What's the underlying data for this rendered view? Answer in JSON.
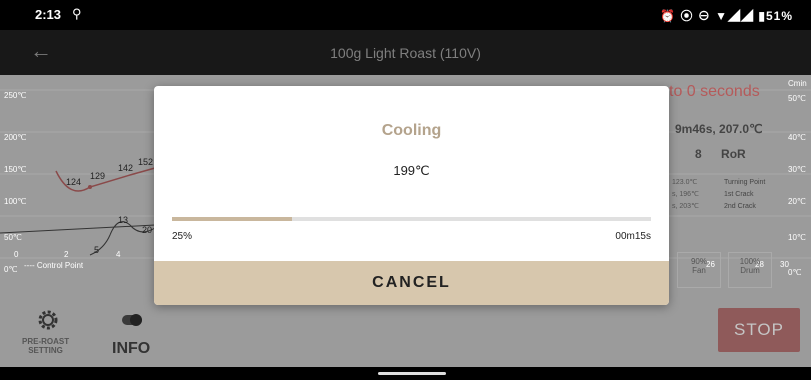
{
  "status_bar": {
    "time": "2:13",
    "battery": "51%",
    "right_icons": "⏰ ⦿ ⊖ ▼◢◢ ▮51%"
  },
  "app_bar": {
    "title": "100g Light Roast (110V)"
  },
  "chart": {
    "y_left": [
      "250℃",
      "200℃",
      "150℃",
      "100℃",
      "50℃",
      "0℃"
    ],
    "y_right": [
      "50℃",
      "40℃",
      "30℃",
      "20℃",
      "10℃",
      "0℃"
    ],
    "x_left": [
      "0",
      "2",
      "4"
    ],
    "x_right": [
      "26",
      "28",
      "30"
    ],
    "min_label": "Cmin",
    "legend": "---- Control Point",
    "marks": {
      "m124": "124",
      "m129": "129",
      "m142": "142",
      "m152": "152",
      "m13": "13",
      "m20": "20",
      "m5": "5"
    },
    "countdown": "to 0 seconds",
    "summary": "9m46s, 207.0℃",
    "summary_count": "8",
    "summary_ror": "RoR",
    "events_left": [
      "123.0℃",
      "s, 196℃",
      "s, 203℃"
    ],
    "events_right": [
      "Turning Point",
      "1st Crack",
      "2nd Crack"
    ],
    "fan": {
      "pct": "90%",
      "label": "Fan"
    },
    "drum": {
      "pct": "100%",
      "label": "Drum"
    }
  },
  "bottom": {
    "preroast_line1": "PRE-ROAST",
    "preroast_line2": "SETTING",
    "info": "INFO",
    "stop": "STOP"
  },
  "dialog": {
    "title": "Cooling",
    "temperature": "199℃",
    "progress": 0.25,
    "progress_label": "25%",
    "remaining": "00m15s",
    "cancel": "CANCEL"
  }
}
